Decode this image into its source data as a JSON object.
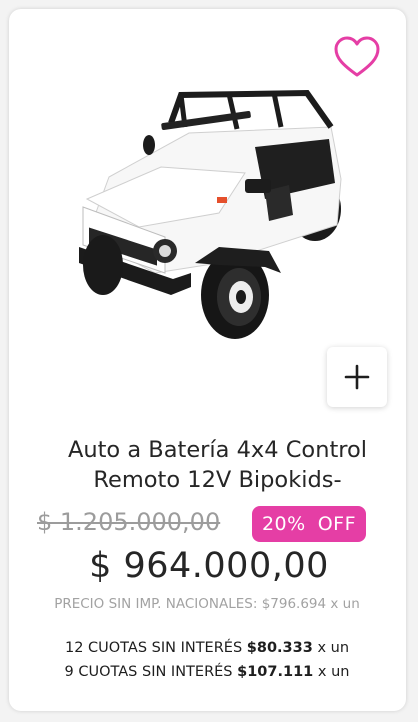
{
  "product": {
    "title": "Auto a Batería 4x4 Control Remoto 12V Bipokids-",
    "old_price": "$ 1.205.000,00",
    "discount_value": "20%",
    "discount_suffix": "OFF",
    "price": "$ 964.000,00",
    "tax_line": "PRECIO SIN IMP. NACIONALES: $796.694 x un"
  },
  "installments": [
    {
      "prefix": "12 CUOTAS SIN INTERÉS",
      "amount": "$80.333",
      "suffix": "x un"
    },
    {
      "prefix": "9 CUOTAS SIN INTERÉS",
      "amount": "$107.111",
      "suffix": "x un"
    }
  ],
  "icons": {
    "favorite": "heart-outline-icon",
    "add": "plus-icon"
  },
  "colors": {
    "accent": "#e53ea5",
    "price_text": "#262626",
    "muted_text": "#a2a2a2"
  }
}
